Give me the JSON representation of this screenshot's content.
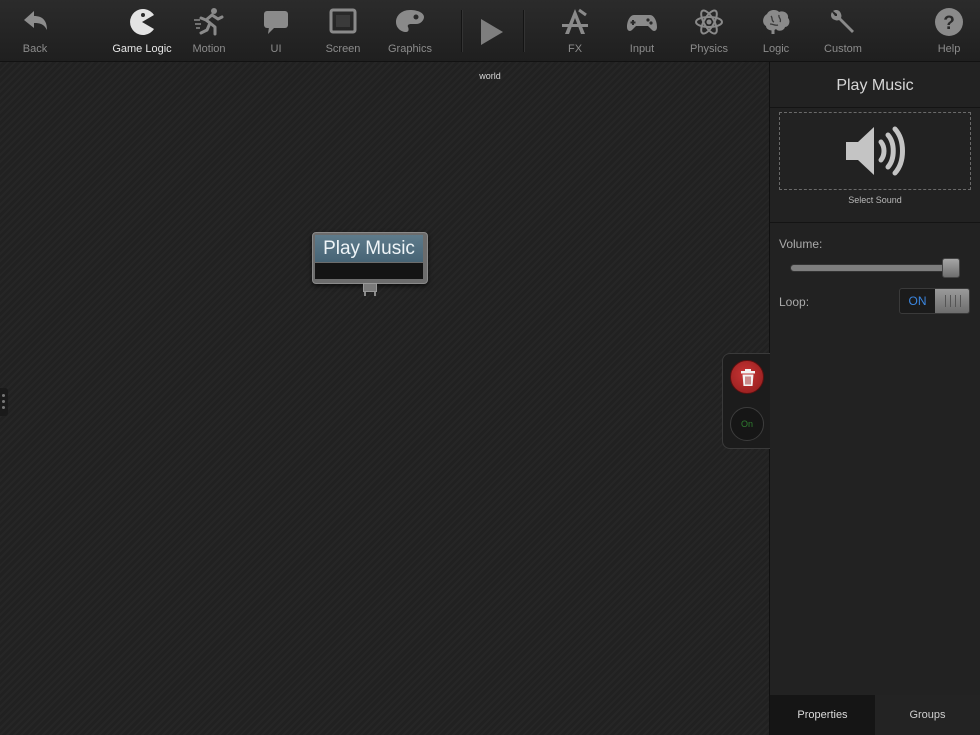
{
  "toolbar": {
    "items": [
      {
        "label": "Back",
        "icon": "back-arrow-icon"
      },
      {
        "label": "Game Logic",
        "icon": "pacman-icon",
        "active": true
      },
      {
        "label": "Motion",
        "icon": "running-man-icon"
      },
      {
        "label": "UI",
        "icon": "speech-bubble-icon"
      },
      {
        "label": "Screen",
        "icon": "screen-icon"
      },
      {
        "label": "Graphics",
        "icon": "palette-icon"
      },
      {
        "label": "FX",
        "icon": "fx-tools-icon"
      },
      {
        "label": "Input",
        "icon": "gamepad-icon"
      },
      {
        "label": "Physics",
        "icon": "atom-icon"
      },
      {
        "label": "Logic",
        "icon": "brain-icon"
      },
      {
        "label": "Custom",
        "icon": "wrench-icon"
      },
      {
        "label": "Help",
        "icon": "help-icon"
      }
    ],
    "play_icon": "play-icon"
  },
  "canvas": {
    "world_label": "world",
    "node": {
      "title": "Play Music"
    },
    "side_actions": {
      "delete_icon": "trash-icon",
      "on_label": "On"
    }
  },
  "panel": {
    "title": "Play Music",
    "sound": {
      "icon": "speaker-icon",
      "select_label": "Select Sound"
    },
    "volume": {
      "label": "Volume:",
      "value": 1.0
    },
    "loop": {
      "label": "Loop:",
      "state": "ON"
    },
    "tabs": [
      {
        "label": "Properties",
        "active": true
      },
      {
        "label": "Groups",
        "active": false
      }
    ]
  },
  "colors": {
    "accent_blue": "#3b86e0",
    "node_header": "#476475",
    "delete_red": "#b52a2a",
    "on_green": "#2f7d2f"
  }
}
